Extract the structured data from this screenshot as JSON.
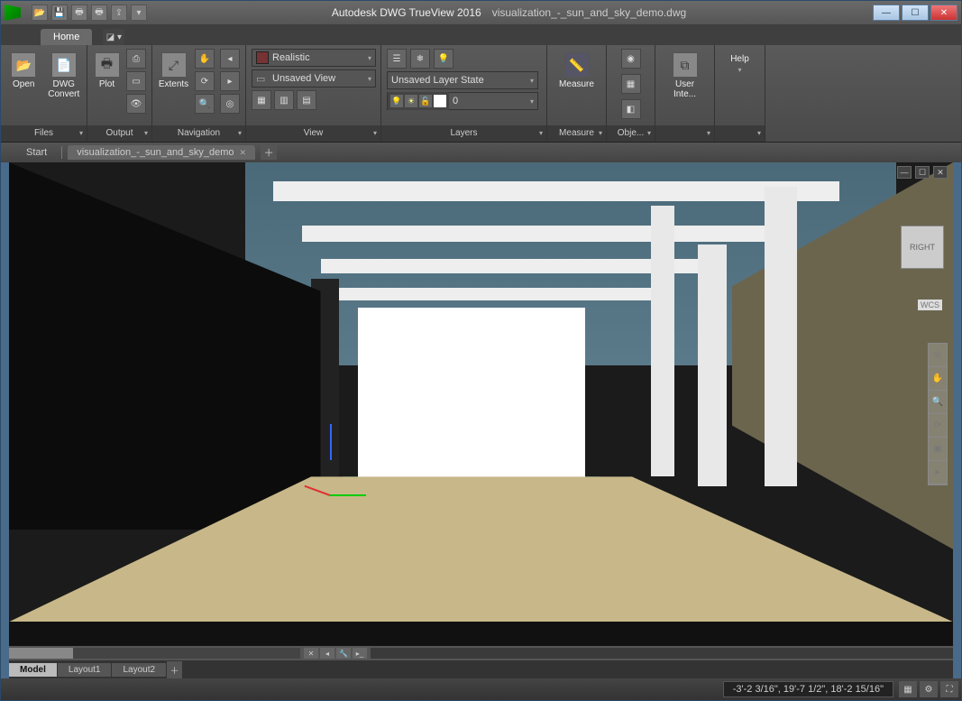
{
  "titlebar": {
    "app_name": "Autodesk DWG TrueView 2016",
    "file_name": "visualization_-_sun_and_sky_demo.dwg"
  },
  "tabs": {
    "home": "Home"
  },
  "ribbon": {
    "files": {
      "title": "Files",
      "open": "Open",
      "dwg_convert": "DWG\nConvert"
    },
    "output": {
      "title": "Output",
      "plot": "Plot"
    },
    "navigation": {
      "title": "Navigation",
      "extents": "Extents"
    },
    "view": {
      "title": "View",
      "visual_style": "Realistic",
      "named_view": "Unsaved View"
    },
    "layers": {
      "title": "Layers",
      "state": "Unsaved Layer State",
      "current": "0"
    },
    "measure": {
      "title": "Measure",
      "measure": "Measure"
    },
    "obj": {
      "label": "Obje..."
    },
    "ui": {
      "label": "User Inte..."
    },
    "help": {
      "label": "Help"
    }
  },
  "filetabs": {
    "start": "Start",
    "file": "visualization_-_sun_and_sky_demo"
  },
  "viewport": {
    "cube_face": "RIGHT",
    "wcs": "WCS"
  },
  "layouts": {
    "model": "Model",
    "l1": "Layout1",
    "l2": "Layout2"
  },
  "status": {
    "coords": "-3'-2 3/16\", 19'-7 1/2\", 18'-2 15/16\""
  }
}
